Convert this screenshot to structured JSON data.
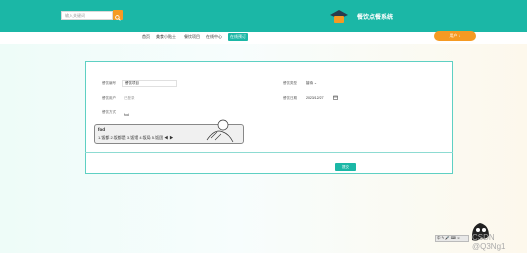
{
  "header": {
    "search_placeholder": "输入关键词",
    "site_title": "餐饮点餐系统"
  },
  "nav": {
    "items": [
      "首页",
      "美食小贴士",
      "餐饮项目",
      "在线中心",
      "在线预订"
    ],
    "active_index": 4,
    "user_label": "用户 ↓"
  },
  "form": {
    "fields": {
      "order_no_label": "餐饮编号",
      "order_no_value": "餐饮项目",
      "user_label": "餐饮用户",
      "user_value": "已登录",
      "method_label": "餐饮方式",
      "method_value": "fod",
      "type_label": "餐饮类型",
      "type_value": "接待",
      "date_label": "餐饮日期",
      "date_value": "2023/12/27"
    },
    "submit_label": "提交"
  },
  "ime": {
    "pinyin": "fod",
    "candidates": "1.饭都  2.饭都是  3.饭馆  4.饭局  5.饭团  ◀ ▶"
  },
  "overlay": {
    "mini_tools": "中 ✎ 🎤 ⌨ ☺",
    "watermark": "CSDN @Q3Ng1"
  },
  "colors": {
    "teal": "#1bb7a6",
    "orange": "#f59a23",
    "card_border": "#5ed0c3"
  }
}
